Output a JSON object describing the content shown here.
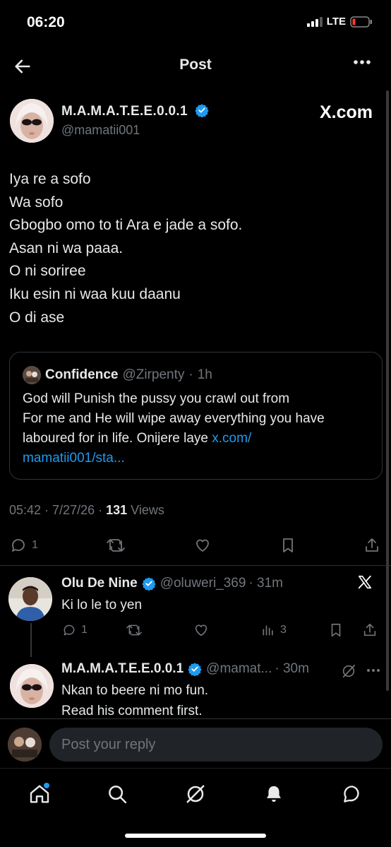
{
  "status_bar": {
    "time": "06:20",
    "network": "LTE"
  },
  "header": {
    "title": "Post"
  },
  "post": {
    "author_name": "M.A.M.A.T.E.E.0.0.1",
    "handle": "@mamatii001",
    "source_label": "X.com",
    "lines": [
      "Iya re a sofo",
      "Wa sofo",
      "Gbogbo omo to ti Ara e jade a sofo.",
      "Asan ni wa paaa.",
      "O ni soriree",
      "Iku esin ni waa kuu daanu",
      "O di ase"
    ],
    "quote": {
      "author_name": "Confidence",
      "handle": "@Zirpenty",
      "time": "1h",
      "text_lines": [
        "God will Punish the pussy you crawl out from",
        "For me and He will wipe away everything you have",
        "laboured for in life. Onijere laye "
      ],
      "link_part1": "x.com/",
      "link_part2": "mamatii001/sta..."
    },
    "timestamp": "05:42 · 7/27/26 · ",
    "views_count": "131",
    "views_label": " Views",
    "reply_count": "1"
  },
  "replies": [
    {
      "author_name": "Olu De Nine",
      "handle": "@oluweri_369",
      "time": "· 31m",
      "text": "Ki lo le to yen",
      "reply_count": "1",
      "views_count": "3"
    },
    {
      "author_name": "M.A.M.A.T.E.E.0.0.1",
      "handle": "@mamat...",
      "time": "· 30m",
      "text_lines": [
        "Nkan to beere ni mo fun.",
        "Read his comment first."
      ]
    }
  ],
  "reply_bar": {
    "placeholder": "Post your reply"
  },
  "colors": {
    "accent": "#1d9bf0",
    "background": "#000000",
    "muted": "#71767b",
    "text": "#e7e9ea"
  },
  "tabs": [
    "home-icon",
    "search-icon",
    "grok-icon",
    "bell-icon",
    "messages-icon"
  ]
}
